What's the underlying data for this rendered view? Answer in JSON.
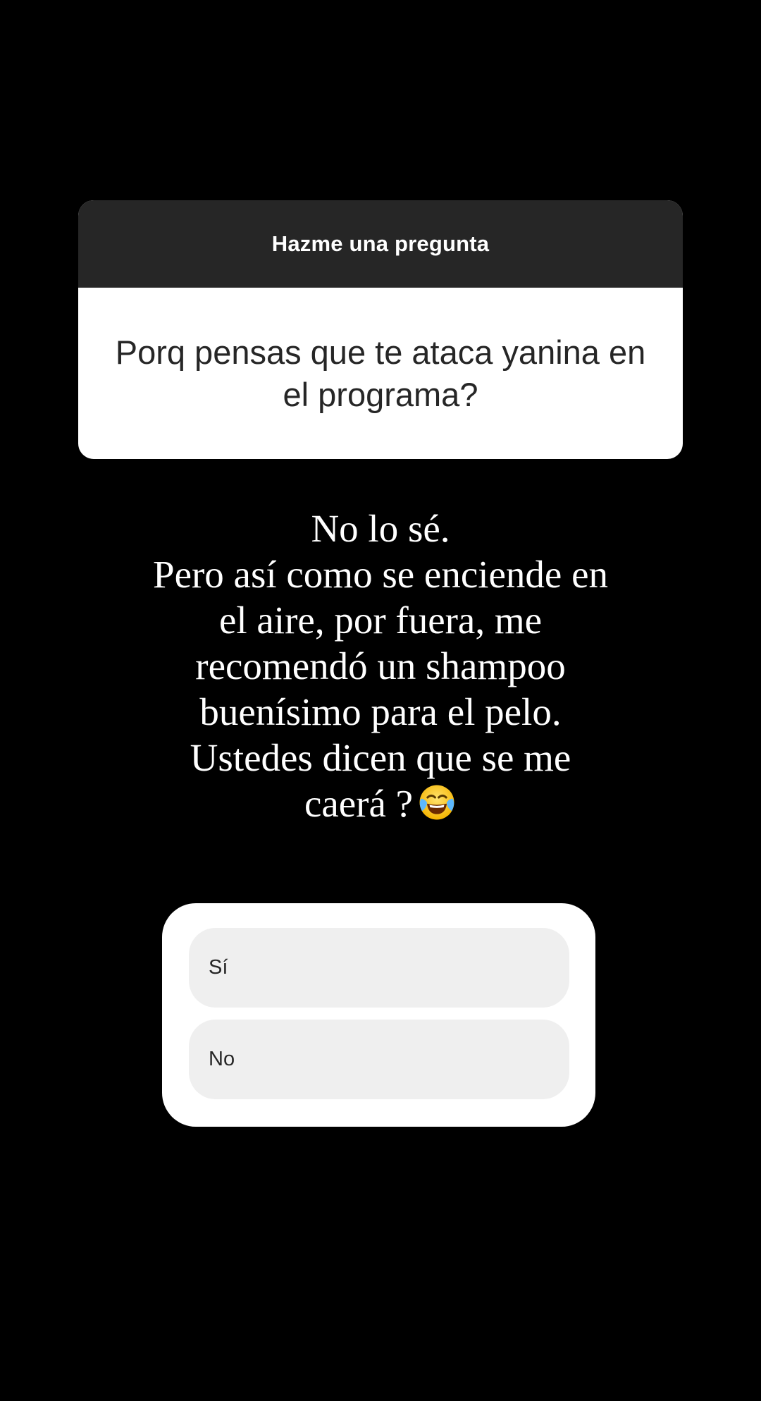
{
  "question_sticker": {
    "header": "Hazme una pregunta",
    "question": "Porq pensas que te ataca yanina en el programa?",
    "header_bg": "#262626",
    "body_bg": "#ffffff"
  },
  "answer": {
    "text": "No lo sé.\nPero así como se enciende en\nel aire, por fuera, me\nrecomendó un shampoo\nbuenísimo para el pelo.\nUstedes dicen que se me\ncaerá ?",
    "emoji": "face-with-tears-of-joy-icon"
  },
  "poll": {
    "options": [
      {
        "label": "Sí"
      },
      {
        "label": "No"
      }
    ],
    "option_bg": "#efefef",
    "card_bg": "#ffffff"
  },
  "colors": {
    "background": "#000000",
    "text_dark": "#262626",
    "text_light": "#ffffff"
  }
}
